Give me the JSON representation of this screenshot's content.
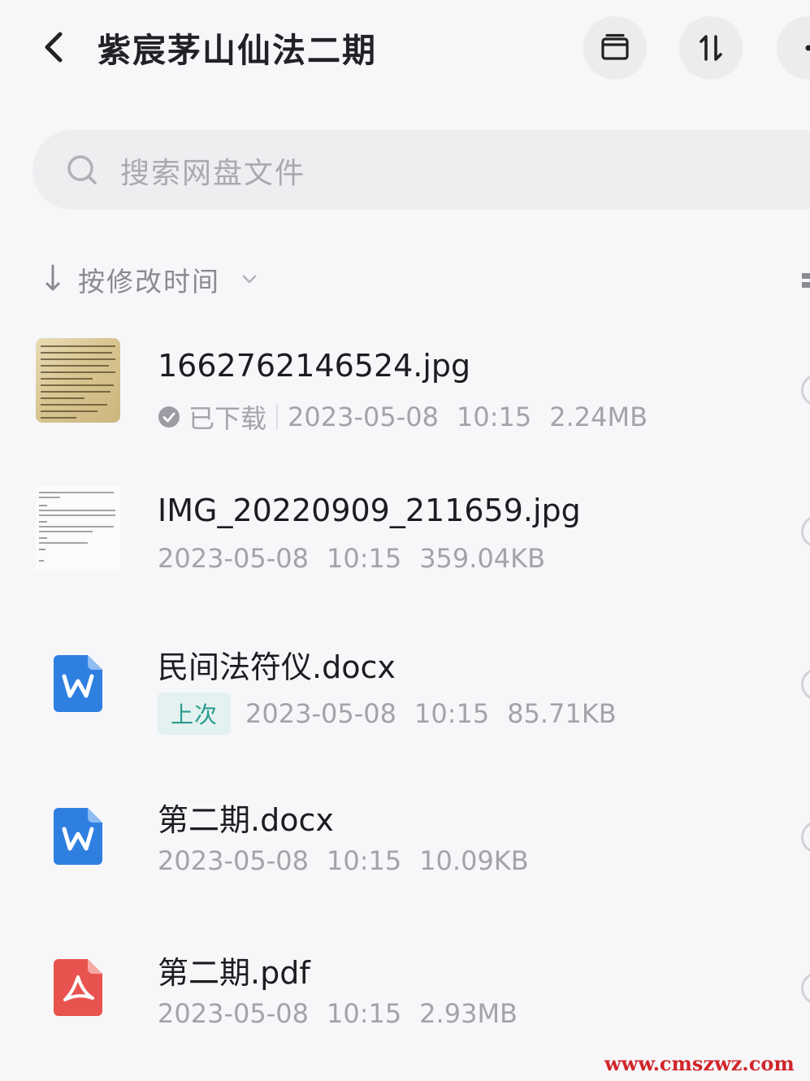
{
  "header": {
    "title": "紫宸茅山仙法二期",
    "actions": [
      "archive-icon",
      "sort-toggle-icon",
      "more-icon"
    ]
  },
  "search": {
    "placeholder": "搜索网盘文件"
  },
  "sort": {
    "label": "按修改时间"
  },
  "files": [
    {
      "name": "1662762146524.jpg",
      "status": "已下载",
      "date": "2023-05-08",
      "time": "10:15",
      "size": "2.24MB",
      "type": "image"
    },
    {
      "name": "IMG_20220909_211659.jpg",
      "date": "2023-05-08",
      "time": "10:15",
      "size": "359.04KB",
      "type": "image"
    },
    {
      "name": "民间法符仪.docx",
      "badge": "上次",
      "date": "2023-05-08",
      "time": "10:15",
      "size": "85.71KB",
      "type": "word"
    },
    {
      "name": "第二期.docx",
      "date": "2023-05-08",
      "time": "10:15",
      "size": "10.09KB",
      "type": "word"
    },
    {
      "name": "第二期.pdf",
      "date": "2023-05-08",
      "time": "10:15",
      "size": "2.93MB",
      "type": "pdf"
    }
  ],
  "colors": {
    "background": "#f7f7f9",
    "word_blue": "#2f7fe0",
    "pdf_red": "#e8534f",
    "badge_green": "#2a9d8f",
    "watermark_red": "#d0262a"
  },
  "watermark": "www.cmszwz.com"
}
